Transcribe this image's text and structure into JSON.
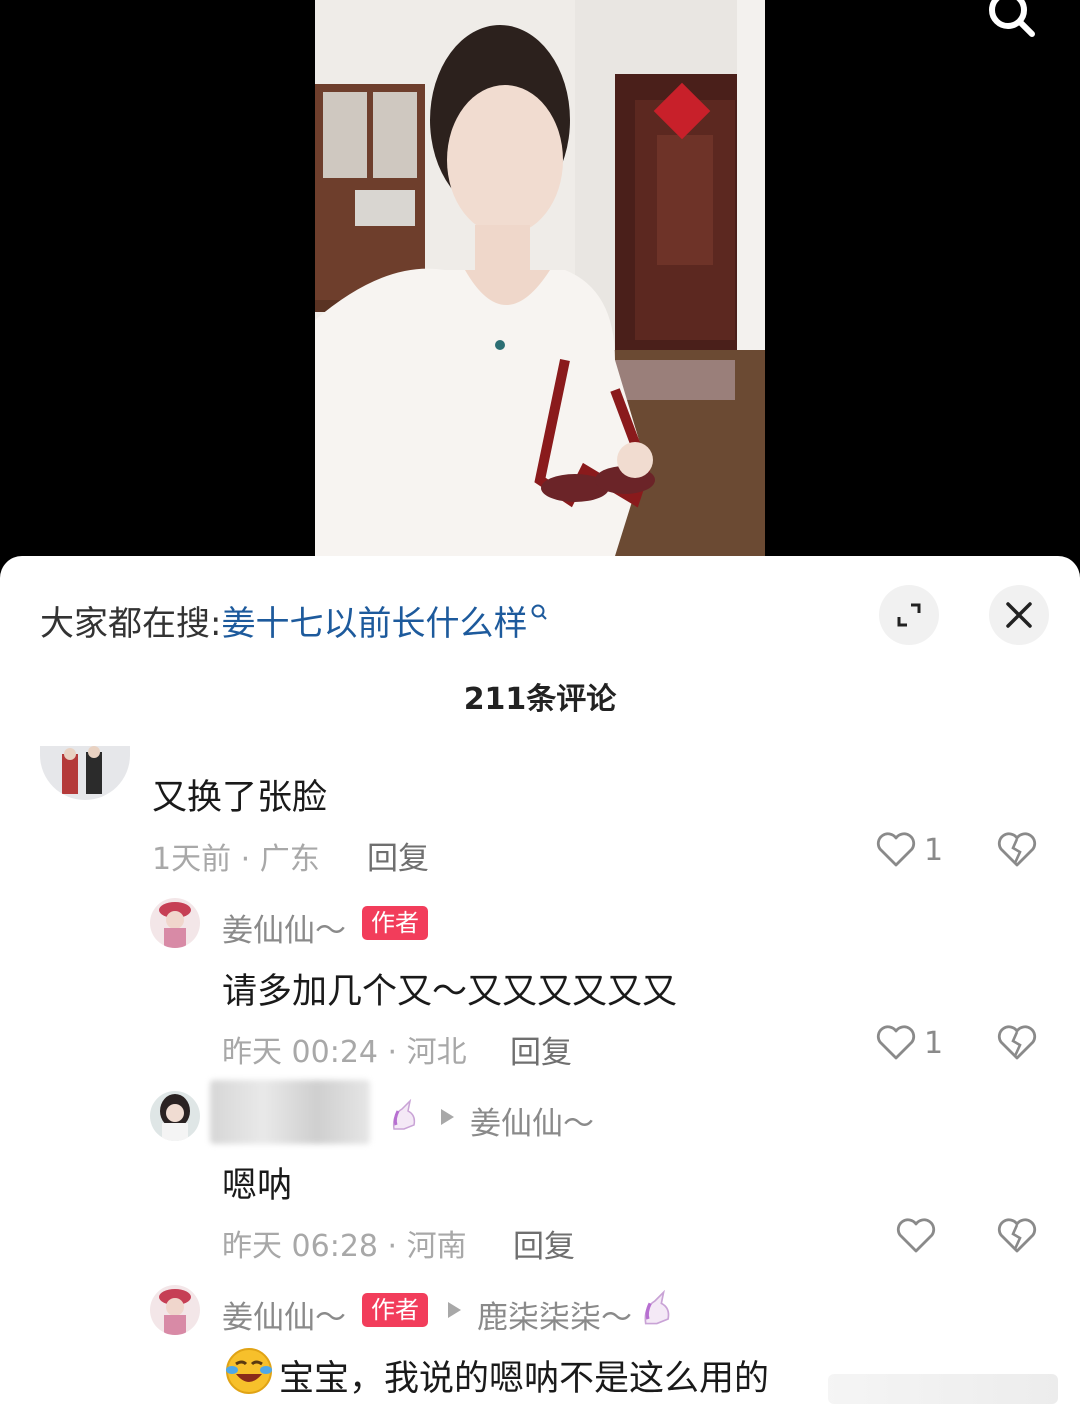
{
  "hot_search": {
    "prefix": "大家都在搜:",
    "keyword": "姜十七以前长什么样"
  },
  "comment_count": "211条评论",
  "comments": [
    {
      "text": "又换了张脸",
      "meta": "1天前 · 广东",
      "reply_label": "回复",
      "likes": "1"
    },
    {
      "name": "姜仙仙～",
      "tag": "作者",
      "text": "请多加几个又～又又又又又又",
      "meta": "昨天 00:24 · 河北",
      "reply_label": "回复",
      "likes": "1"
    },
    {
      "reply_to": "姜仙仙～",
      "text": "嗯呐",
      "meta": "昨天 06:28 · 河南",
      "reply_label": "回复"
    },
    {
      "name": "姜仙仙～",
      "tag": "作者",
      "reply_to": "鹿柒柒柒～",
      "text": "宝宝，我说的嗯呐不是这么用的"
    }
  ],
  "colors": {
    "keyword": "#1d5a9c",
    "author_tag": "#f23d5b",
    "meta_text": "#a8a8a8"
  }
}
